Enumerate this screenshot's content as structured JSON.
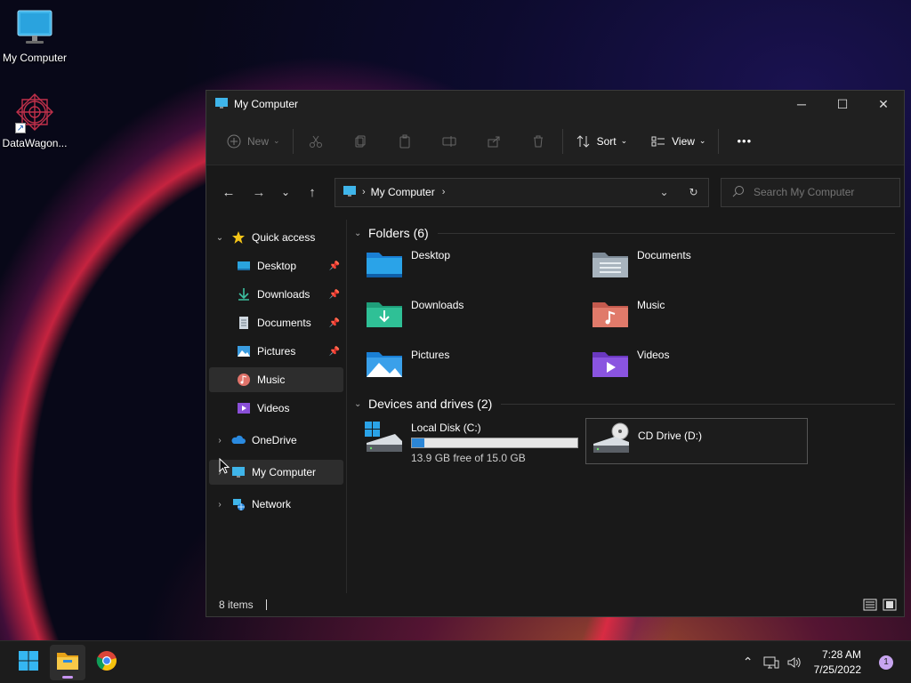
{
  "desktop": {
    "icons": [
      {
        "label": "My Computer",
        "icon": "monitor-icon"
      },
      {
        "label": "DataWagon...",
        "icon": "datawagon-logo-icon"
      }
    ]
  },
  "window": {
    "title": "My Computer",
    "controls": {
      "minimize": "─",
      "maximize": "☐",
      "close": "✕"
    },
    "command_bar": {
      "new_label": "New",
      "sort_label": "Sort",
      "view_label": "View",
      "more_label": "•••"
    },
    "address": {
      "crumb": "My Computer",
      "search_placeholder": "Search My Computer"
    },
    "nav": {
      "quick_access": "Quick access",
      "items": [
        {
          "label": "Desktop",
          "pinned": true
        },
        {
          "label": "Downloads",
          "pinned": true
        },
        {
          "label": "Documents",
          "pinned": true
        },
        {
          "label": "Pictures",
          "pinned": true
        },
        {
          "label": "Music",
          "pinned": false,
          "selected": true
        },
        {
          "label": "Videos",
          "pinned": false
        }
      ],
      "onedrive": "OneDrive",
      "my_computer": "My Computer",
      "network": "Network"
    },
    "main": {
      "folders_heading": "Folders (6)",
      "folders": [
        {
          "name": "Desktop",
          "icon": "desktop-folder-icon"
        },
        {
          "name": "Documents",
          "icon": "documents-folder-icon"
        },
        {
          "name": "Downloads",
          "icon": "downloads-folder-icon"
        },
        {
          "name": "Music",
          "icon": "music-folder-icon"
        },
        {
          "name": "Pictures",
          "icon": "pictures-folder-icon"
        },
        {
          "name": "Videos",
          "icon": "videos-folder-icon"
        }
      ],
      "drives_heading": "Devices and drives (2)",
      "drives": [
        {
          "name": "Local Disk (C:)",
          "free_text": "13.9 GB free of 15.0 GB",
          "used_fraction": 0.073
        },
        {
          "name": "CD Drive (D:)"
        }
      ]
    },
    "status": {
      "items": "8 items"
    }
  },
  "taskbar": {
    "time": "7:28 AM",
    "date": "7/25/2022",
    "notification_count": "1"
  },
  "colors": {
    "accent": "#2b86d6",
    "window_bg": "#191919",
    "selection_bg": "#2d2d2d"
  }
}
